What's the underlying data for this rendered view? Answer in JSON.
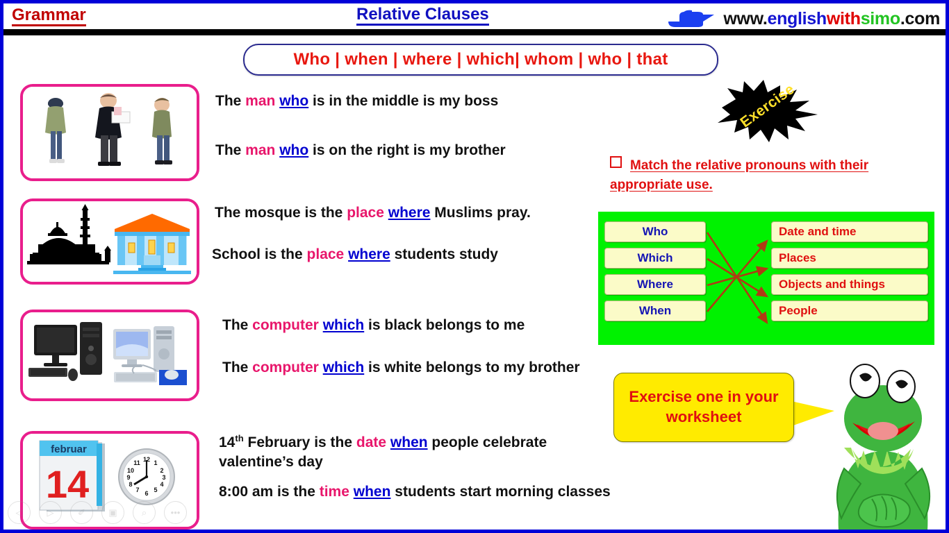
{
  "header": {
    "grammar_label": "Grammar",
    "title": "Relative Clauses",
    "url": {
      "www": "www.",
      "english": "english",
      "with": "with",
      "simo": "simo",
      "com": ".com"
    },
    "hand_icon": "pointing-hand-icon"
  },
  "banner": {
    "text": "Who | when | where | which| whom | who | that"
  },
  "examples": [
    {
      "image": "three-men-photo",
      "lines": [
        {
          "pre": "The ",
          "noun": "man",
          "mid": " ",
          "pronoun": "who",
          "post": " is in the middle is my boss"
        },
        {
          "pre": "The ",
          "noun": "man",
          "mid": " ",
          "pronoun": "who",
          "post": " is on the right is my brother"
        }
      ]
    },
    {
      "image": "mosque-and-school-illustration",
      "lines": [
        {
          "pre": "The mosque is the ",
          "noun": "place",
          "mid": " ",
          "pronoun": "where",
          "post": " Muslims pray."
        },
        {
          "pre": "School is the ",
          "noun": "place",
          "mid": " ",
          "pronoun": "where",
          "post": " students study"
        }
      ]
    },
    {
      "image": "two-desktop-computers-illustration",
      "lines": [
        {
          "pre": "The ",
          "noun": "computer",
          "mid": " ",
          "pronoun": "which",
          "post": " is black belongs to me"
        },
        {
          "pre": "The ",
          "noun": "computer",
          "mid": " ",
          "pronoun": "which",
          "post": " is white belongs to my brother"
        }
      ]
    },
    {
      "image": "calendar-february-14-and-clock-illustration",
      "calendar_month": "februar",
      "calendar_day": "14",
      "lines": [
        {
          "pre_num": "14",
          "sup": "th",
          "pre": " February is the ",
          "noun": "date",
          "mid": " ",
          "pronoun": "when",
          "post": " people celebrate valentine’s day"
        },
        {
          "pre": "8:00 am is the ",
          "noun": "time",
          "mid": " ",
          "pronoun": "when",
          "post": " students start morning classes"
        }
      ]
    }
  ],
  "exercise": {
    "burst_label": "Exercise",
    "instruction": "Match the relative pronouns with their appropriate use.",
    "bullet_icon": "square-bullet-icon"
  },
  "matching": {
    "left": [
      "Who",
      "Which",
      "Where",
      "When"
    ],
    "right": [
      "Date and time",
      "Places",
      "Objects and things",
      "People"
    ],
    "connections": [
      {
        "from": "Who",
        "to": "People"
      },
      {
        "from": "Which",
        "to": "Objects and things"
      },
      {
        "from": "Where",
        "to": "Places"
      },
      {
        "from": "When",
        "to": "Date and time"
      }
    ],
    "background_color": "#00f200",
    "box_color": "#fbfbc8",
    "left_text_color": "#1414b4",
    "right_text_color": "#e01010",
    "arrow_color": "#b03a14"
  },
  "bubble": {
    "text": "Exercise one in your worksheet"
  },
  "frog": {
    "name": "kermit-frog-illustration"
  },
  "toolbar": {
    "buttons": [
      {
        "name": "previous-slide-button",
        "glyph": "◁"
      },
      {
        "name": "next-slide-button",
        "glyph": "▷"
      },
      {
        "name": "pen-tool-button",
        "glyph": "✐"
      },
      {
        "name": "all-slides-button",
        "glyph": "▣"
      },
      {
        "name": "zoom-button",
        "glyph": "⌕"
      },
      {
        "name": "more-options-button",
        "glyph": "•••"
      }
    ]
  }
}
